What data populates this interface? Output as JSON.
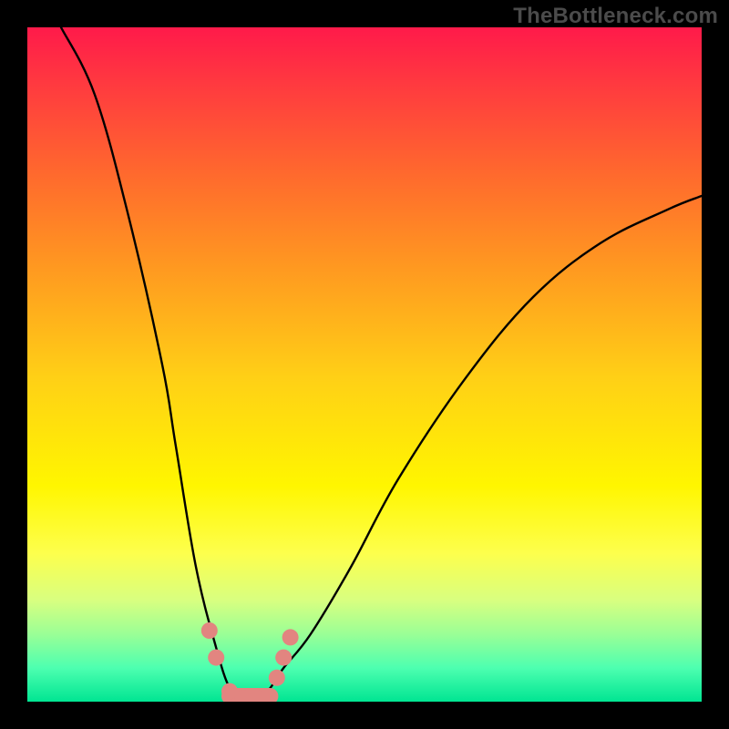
{
  "watermark": "TheBottleneck.com",
  "colors": {
    "background": "#000000",
    "curve": "#000000",
    "markers": "#e28580",
    "gradient_top": "#ff1a4a",
    "gradient_bottom": "#00e592"
  },
  "chart_data": {
    "type": "line",
    "title": "",
    "xlabel": "",
    "ylabel": "",
    "xlim": [
      0,
      100
    ],
    "ylim": [
      0,
      100
    ],
    "grid": false,
    "legend": false,
    "notes": "Rainbow background from red (high/bad) to green (low/good). Black v-shaped curve. Salmon-colored dots and short segment near the trough indicate optimal region. No numeric axis ticks visible; values are estimated from position.",
    "series": [
      {
        "name": "curve",
        "x": [
          5,
          10,
          15,
          20,
          22,
          25,
          28,
          30,
          32,
          34,
          36,
          38,
          42,
          48,
          55,
          65,
          75,
          85,
          95,
          100
        ],
        "y": [
          100,
          90,
          72,
          50,
          38,
          20,
          8,
          2,
          0,
          0,
          2,
          5,
          10,
          20,
          33,
          48,
          60,
          68,
          73,
          75
        ]
      },
      {
        "name": "optimal-markers",
        "type": "scatter",
        "x": [
          27,
          28,
          30,
          32,
          34,
          37,
          38,
          39
        ],
        "y": [
          10,
          6,
          1,
          0,
          0,
          3,
          6,
          9
        ]
      },
      {
        "name": "optimal-segment",
        "type": "line",
        "x": [
          30,
          36
        ],
        "y": [
          0,
          0
        ]
      }
    ]
  }
}
